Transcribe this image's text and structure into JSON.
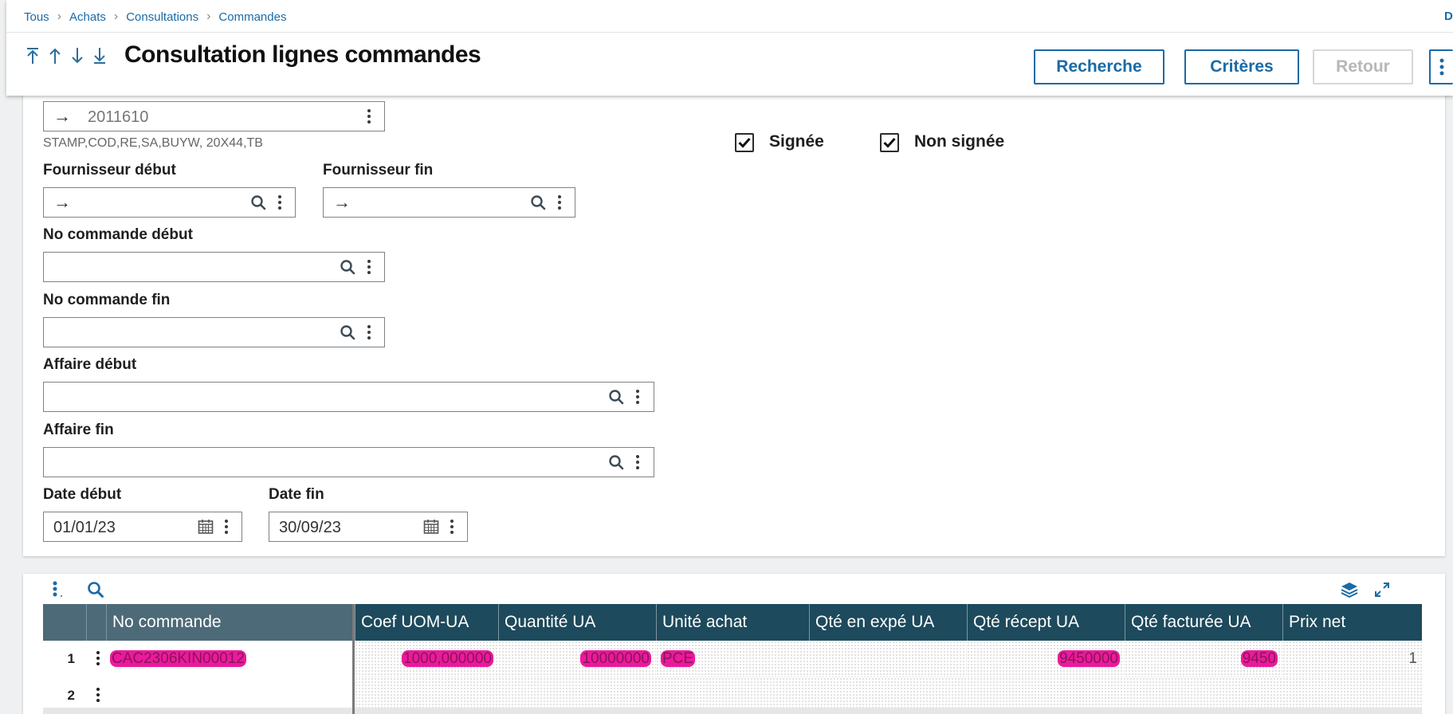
{
  "breadcrumb": [
    "Tous",
    "Achats",
    "Consultations",
    "Commandes"
  ],
  "breadcrumb_right": "D",
  "page_title": "Consultation lignes commandes",
  "nav_icons": [
    "first-record-icon",
    "previous-record-icon",
    "next-record-icon",
    "last-record-icon"
  ],
  "actions": {
    "search": "Recherche",
    "criteria": "Critères",
    "back": "Retour"
  },
  "form": {
    "top_field_value": "2011610",
    "top_field_desc": "STAMP,COD,RE,SA,BUYW, 20X44,TB",
    "supplier_start_label": "Fournisseur début",
    "supplier_end_label": "Fournisseur fin",
    "order_start_label": "No commande début",
    "order_end_label": "No commande fin",
    "project_start_label": "Affaire début",
    "project_end_label": "Affaire fin",
    "date_start_label": "Date début",
    "date_start_value": "01/01/23",
    "date_end_label": "Date fin",
    "date_end_value": "30/09/23",
    "signed_label": "Signée",
    "signed_checked": true,
    "unsigned_label": "Non signée",
    "unsigned_checked": true
  },
  "grid": {
    "columns": [
      "No commande",
      "Coef UOM-UA",
      "Quantité UA",
      "Unité achat",
      "Qté en expé UA",
      "Qté récept UA",
      "Qté facturée UA",
      "Prix net"
    ],
    "rows": [
      {
        "num": "1",
        "order": "CAC2306KIN00012",
        "coef": "1000,000000",
        "qty": "10000000",
        "unit": "PCE",
        "ship": "",
        "recv": "9450000",
        "inv": "9450",
        "price": "1"
      },
      {
        "num": "2",
        "order": "",
        "coef": "",
        "qty": "",
        "unit": "",
        "ship": "",
        "recv": "",
        "inv": "",
        "price": ""
      }
    ]
  },
  "colors": {
    "accent": "#1a6aa6",
    "grid_header": "#1d4a5c",
    "grid_header_frozen": "#4d6a78",
    "highlight": "#ea1a9c"
  }
}
